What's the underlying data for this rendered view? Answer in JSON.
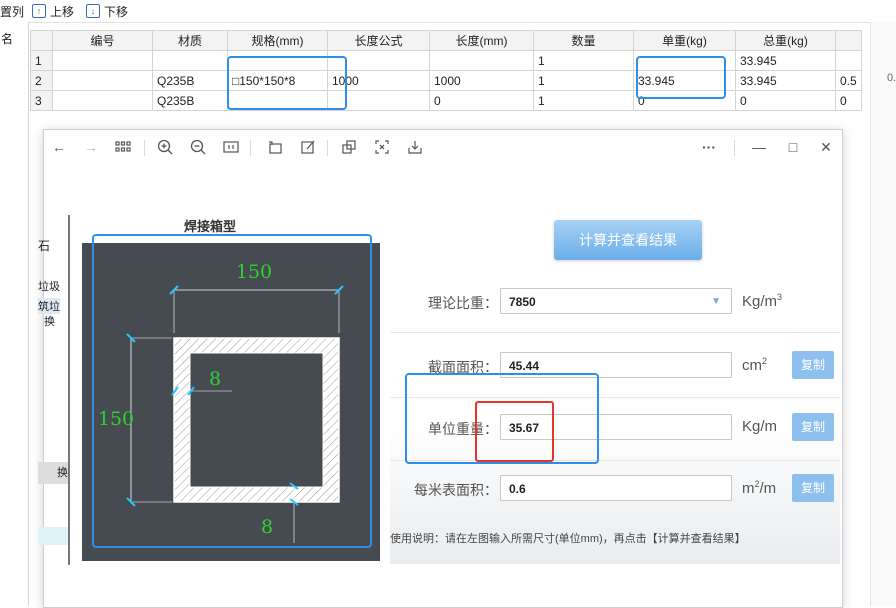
{
  "toolbar": {
    "setcol_label": "置列",
    "move_up_label": "上移",
    "move_down_label": "下移"
  },
  "left_panel": {
    "header": "名",
    "stub_texts": [
      "石",
      "垃圾",
      "筑垃",
      "换",
      "换"
    ]
  },
  "grid": {
    "columns": [
      "",
      "编号",
      "材质",
      "规格(mm)",
      "长度公式",
      "长度(mm)",
      "数量",
      "单重(kg)",
      "总重(kg)",
      ""
    ],
    "rows": [
      [
        "1",
        "",
        "",
        "",
        "",
        "",
        "1",
        "",
        "33.945",
        ""
      ],
      [
        "2",
        "",
        "Q235B",
        "□150*150*8",
        "1000",
        "1000",
        "1",
        "33.945",
        "33.945",
        "0.5"
      ],
      [
        "3",
        "",
        "Q235B",
        "",
        "",
        "0",
        "1",
        "0",
        "0",
        "0"
      ]
    ]
  },
  "calc_window": {
    "section_title": "焊接箱型",
    "diagram": {
      "width_label": "150",
      "height_label": "150",
      "web_thickness_label": "8",
      "flange_thickness_label": "8"
    },
    "calc_button": "计算并查看结果",
    "fields": {
      "density": {
        "label": "理论比重：",
        "value": "7850",
        "unit": "Kg/m",
        "unit_sup": "3"
      },
      "area": {
        "label": "截面面积：",
        "value": "45.44",
        "unit": "cm",
        "unit_sup": "2",
        "copy": "复制"
      },
      "unit_weight": {
        "label": "单位重量：",
        "value": "35.67",
        "unit": "Kg/m",
        "copy": "复制"
      },
      "surface": {
        "label": "每米表面积：",
        "value": "0.6",
        "unit": "m",
        "unit_sup": "2",
        "unit_tail": "/m",
        "copy": "复制"
      }
    },
    "usage_note": "使用说明：请在左图输入所需尺寸(单位mm)，再点击【计算并查看结果】"
  },
  "colors": {
    "highlight_blue": "#2f8fe8",
    "highlight_red": "#e8332a",
    "diagram_bg": "#464a51",
    "dimension_green": "#2fd12f",
    "button_blue": "#8dc0ef"
  }
}
